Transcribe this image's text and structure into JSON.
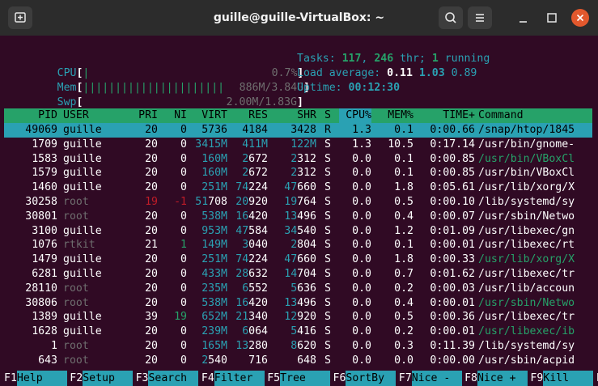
{
  "window": {
    "title": "guille@guille-VirtualBox: ~",
    "colors": {
      "titlebar": "#2c2c2c",
      "background": "#300a24",
      "close": "#e2582d"
    }
  },
  "meters": {
    "cpu": {
      "label": "CPU",
      "bar": "|",
      "value": "0.7%"
    },
    "mem": {
      "label": "Mem",
      "bar": "||||||||||||||||||||||",
      "value": "886M/3.84G"
    },
    "swp": {
      "label": "Swp",
      "bar": "",
      "value": "2.00M/1.83G"
    }
  },
  "summary": {
    "tasks_label": "Tasks:",
    "tasks": "117",
    "thr": "246",
    "thr_label": "thr;",
    "running": "1",
    "running_label": "running",
    "load_label": "Load average:",
    "load1": "0.11",
    "load5": "1.03",
    "load15": "0.89",
    "uptime_label": "Uptime:",
    "uptime": "00:12:30"
  },
  "columns": [
    "PID",
    "USER",
    "PRI",
    "NI",
    "VIRT",
    "RES",
    "SHR",
    "S",
    "CPU%",
    "MEM%",
    "TIME+",
    "Command"
  ],
  "processes": [
    {
      "pid": "49069",
      "user": "guille",
      "pri": "20",
      "ni": "0",
      "virt": "5736",
      "res": "4184",
      "shr": "3428",
      "s": "R",
      "cpu": "1.3",
      "mem": "0.1",
      "time": "0:00.66",
      "cmd": "/snap/htop/1845"
    },
    {
      "pid": "1709",
      "user": "guille",
      "pri": "20",
      "ni": "0",
      "virt": "3415M",
      "res": "411M",
      "shr": "122M",
      "s": "S",
      "cpu": "1.3",
      "mem": "10.5",
      "time": "0:17.14",
      "cmd": "/usr/bin/gnome-"
    },
    {
      "pid": "1583",
      "user": "guille",
      "pri": "20",
      "ni": "0",
      "virt": "160M",
      "res": "2672",
      "shr": "2312",
      "s": "S",
      "cpu": "0.0",
      "mem": "0.1",
      "time": "0:00.85",
      "cmd": "/usr/bin/VBoxCl"
    },
    {
      "pid": "1579",
      "user": "guille",
      "pri": "20",
      "ni": "0",
      "virt": "160M",
      "res": "2672",
      "shr": "2312",
      "s": "S",
      "cpu": "0.0",
      "mem": "0.1",
      "time": "0:00.85",
      "cmd": "/usr/bin/VBoxCl"
    },
    {
      "pid": "1460",
      "user": "guille",
      "pri": "20",
      "ni": "0",
      "virt": "251M",
      "res": "74224",
      "shr": "47660",
      "s": "S",
      "cpu": "0.0",
      "mem": "1.8",
      "time": "0:05.61",
      "cmd": "/usr/lib/xorg/X"
    },
    {
      "pid": "30258",
      "user": "root",
      "pri": "19",
      "ni": "-1",
      "virt": "51708",
      "res": "20920",
      "shr": "19764",
      "s": "S",
      "cpu": "0.0",
      "mem": "0.5",
      "time": "0:00.10",
      "cmd": "/lib/systemd/sy"
    },
    {
      "pid": "30801",
      "user": "root",
      "pri": "20",
      "ni": "0",
      "virt": "538M",
      "res": "16420",
      "shr": "13496",
      "s": "S",
      "cpu": "0.0",
      "mem": "0.4",
      "time": "0:00.07",
      "cmd": "/usr/sbin/Netwo"
    },
    {
      "pid": "3100",
      "user": "guille",
      "pri": "20",
      "ni": "0",
      "virt": "953M",
      "res": "47584",
      "shr": "34540",
      "s": "S",
      "cpu": "0.0",
      "mem": "1.2",
      "time": "0:01.09",
      "cmd": "/usr/libexec/gn"
    },
    {
      "pid": "1076",
      "user": "rtkit",
      "pri": "21",
      "ni": "1",
      "virt": "149M",
      "res": "3040",
      "shr": "2804",
      "s": "S",
      "cpu": "0.0",
      "mem": "0.1",
      "time": "0:00.01",
      "cmd": "/usr/libexec/rt"
    },
    {
      "pid": "1479",
      "user": "guille",
      "pri": "20",
      "ni": "0",
      "virt": "251M",
      "res": "74224",
      "shr": "47660",
      "s": "S",
      "cpu": "0.0",
      "mem": "1.8",
      "time": "0:00.33",
      "cmd": "/usr/lib/xorg/X"
    },
    {
      "pid": "6281",
      "user": "guille",
      "pri": "20",
      "ni": "0",
      "virt": "433M",
      "res": "28632",
      "shr": "14704",
      "s": "S",
      "cpu": "0.0",
      "mem": "0.7",
      "time": "0:01.62",
      "cmd": "/usr/libexec/tr"
    },
    {
      "pid": "28110",
      "user": "root",
      "pri": "20",
      "ni": "0",
      "virt": "235M",
      "res": "6552",
      "shr": "5636",
      "s": "S",
      "cpu": "0.0",
      "mem": "0.2",
      "time": "0:00.03",
      "cmd": "/usr/lib/accoun"
    },
    {
      "pid": "30806",
      "user": "root",
      "pri": "20",
      "ni": "0",
      "virt": "538M",
      "res": "16420",
      "shr": "13496",
      "s": "S",
      "cpu": "0.0",
      "mem": "0.4",
      "time": "0:00.01",
      "cmd": "/usr/sbin/Netwo"
    },
    {
      "pid": "1389",
      "user": "guille",
      "pri": "39",
      "ni": "19",
      "virt": "652M",
      "res": "21340",
      "shr": "12920",
      "s": "S",
      "cpu": "0.0",
      "mem": "0.5",
      "time": "0:00.36",
      "cmd": "/usr/libexec/tr"
    },
    {
      "pid": "1628",
      "user": "guille",
      "pri": "20",
      "ni": "0",
      "virt": "239M",
      "res": "6064",
      "shr": "5416",
      "s": "S",
      "cpu": "0.0",
      "mem": "0.2",
      "time": "0:00.01",
      "cmd": "/usr/libexec/ib"
    },
    {
      "pid": "1",
      "user": "root",
      "pri": "20",
      "ni": "0",
      "virt": "165M",
      "res": "13280",
      "shr": "8620",
      "s": "S",
      "cpu": "0.0",
      "mem": "0.3",
      "time": "0:11.39",
      "cmd": "/lib/systemd/sy"
    },
    {
      "pid": "643",
      "user": "root",
      "pri": "20",
      "ni": "0",
      "virt": "2540",
      "res": "716",
      "shr": "648",
      "s": "S",
      "cpu": "0.0",
      "mem": "0.0",
      "time": "0:00.00",
      "cmd": "/usr/sbin/acpid"
    }
  ],
  "fkeys": [
    {
      "key": "F1",
      "label": "Help  "
    },
    {
      "key": "F2",
      "label": "Setup "
    },
    {
      "key": "F3",
      "label": "Search"
    },
    {
      "key": "F4",
      "label": "Filter"
    },
    {
      "key": "F5",
      "label": "Tree  "
    },
    {
      "key": "F6",
      "label": "SortBy"
    },
    {
      "key": "F7",
      "label": "Nice -"
    },
    {
      "key": "F8",
      "label": "Nice +"
    },
    {
      "key": "F9",
      "label": "Kill  "
    },
    {
      "key": "F",
      "label": ""
    }
  ]
}
